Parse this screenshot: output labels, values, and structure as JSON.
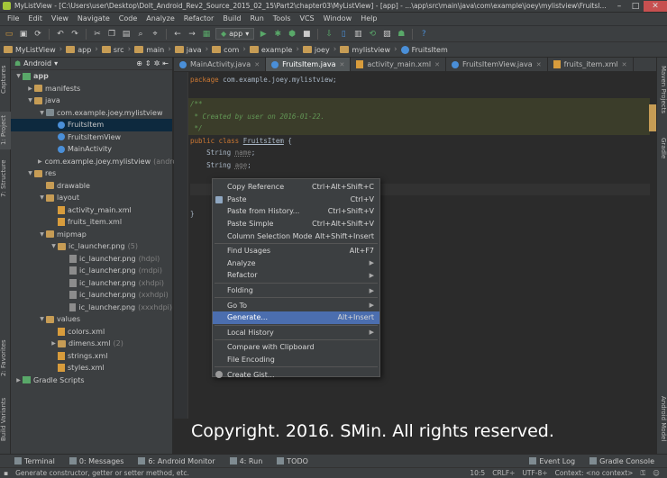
{
  "window": {
    "title": "MyListView - [C:\\Users\\user\\Desktop\\DoIt_Android_Rev2_Source_2015_02_15\\Part2\\chapter03\\MyListView] - [app] - ...\\app\\src\\main\\java\\com\\example\\joey\\mylistview\\FruitsI..."
  },
  "menu": [
    "File",
    "Edit",
    "View",
    "Navigate",
    "Code",
    "Analyze",
    "Refactor",
    "Build",
    "Run",
    "Tools",
    "VCS",
    "Window",
    "Help"
  ],
  "toolbar": {
    "run_config": "app"
  },
  "breadcrumb": [
    "MyListView",
    "app",
    "src",
    "main",
    "java",
    "com",
    "example",
    "joey",
    "mylistview",
    "FruitsItem"
  ],
  "side_tabs_left": [
    "Captures",
    "1: Project",
    "7: Structure",
    "2: Favorites",
    "Build Variants"
  ],
  "side_tabs_right": [
    "Maven Projects",
    "Gradle",
    "Android Model"
  ],
  "project": {
    "view_mode": "Android",
    "tree": [
      {
        "label": "app",
        "indent": 0,
        "arrow": "▼",
        "icon": "mod",
        "bold": true
      },
      {
        "label": "manifests",
        "indent": 1,
        "arrow": "▶",
        "icon": "folder"
      },
      {
        "label": "java",
        "indent": 1,
        "arrow": "▼",
        "icon": "folder"
      },
      {
        "label": "com.example.joey.mylistview",
        "indent": 2,
        "arrow": "▼",
        "icon": "pkg"
      },
      {
        "label": "FruitsItem",
        "indent": 3,
        "arrow": "",
        "icon": "cls",
        "selected": true
      },
      {
        "label": "FruitsItemView",
        "indent": 3,
        "arrow": "",
        "icon": "cls"
      },
      {
        "label": "MainActivity",
        "indent": 3,
        "arrow": "",
        "icon": "cls"
      },
      {
        "label": "com.example.joey.mylistview",
        "suffix": "(andro",
        "indent": 2,
        "arrow": "▶",
        "icon": "pkg"
      },
      {
        "label": "res",
        "indent": 1,
        "arrow": "▼",
        "icon": "folder"
      },
      {
        "label": "drawable",
        "indent": 2,
        "arrow": "",
        "icon": "folder"
      },
      {
        "label": "layout",
        "indent": 2,
        "arrow": "▼",
        "icon": "folder"
      },
      {
        "label": "activity_main.xml",
        "indent": 3,
        "arrow": "",
        "icon": "xml"
      },
      {
        "label": "fruits_item.xml",
        "indent": 3,
        "arrow": "",
        "icon": "xml"
      },
      {
        "label": "mipmap",
        "indent": 2,
        "arrow": "▼",
        "icon": "folder"
      },
      {
        "label": "ic_launcher.png",
        "suffix": "(5)",
        "indent": 3,
        "arrow": "▼",
        "icon": "folder"
      },
      {
        "label": "ic_launcher.png",
        "suffix": "(hdpi)",
        "indent": 4,
        "arrow": "",
        "icon": "png"
      },
      {
        "label": "ic_launcher.png",
        "suffix": "(mdpi)",
        "indent": 4,
        "arrow": "",
        "icon": "png"
      },
      {
        "label": "ic_launcher.png",
        "suffix": "(xhdpi)",
        "indent": 4,
        "arrow": "",
        "icon": "png"
      },
      {
        "label": "ic_launcher.png",
        "suffix": "(xxhdpi)",
        "indent": 4,
        "arrow": "",
        "icon": "png"
      },
      {
        "label": "ic_launcher.png",
        "suffix": "(xxxhdpi)",
        "indent": 4,
        "arrow": "",
        "icon": "png"
      },
      {
        "label": "values",
        "indent": 2,
        "arrow": "▼",
        "icon": "folder"
      },
      {
        "label": "colors.xml",
        "indent": 3,
        "arrow": "",
        "icon": "xml"
      },
      {
        "label": "dimens.xml",
        "suffix": "(2)",
        "indent": 3,
        "arrow": "▶",
        "icon": "folder"
      },
      {
        "label": "strings.xml",
        "indent": 3,
        "arrow": "",
        "icon": "xml"
      },
      {
        "label": "styles.xml",
        "indent": 3,
        "arrow": "",
        "icon": "xml"
      },
      {
        "label": "Gradle Scripts",
        "indent": 0,
        "arrow": "▶",
        "icon": "mod"
      }
    ]
  },
  "tabs": [
    {
      "label": "MainActivity.java",
      "active": false
    },
    {
      "label": "FruitsItem.java",
      "active": true
    },
    {
      "label": "activity_main.xml",
      "active": false
    },
    {
      "label": "FruitsItemView.java",
      "active": false
    },
    {
      "label": "fruits_item.xml",
      "active": false
    }
  ],
  "code": {
    "package_kw": "package",
    "package_name": "com.example.joey.mylistview;",
    "comment_open": "/**",
    "comment_body": " * Created by user on 2016-01-22.",
    "comment_close": " */",
    "class_decl_kw": "public class",
    "class_name": "FruitsItem",
    "class_brace": "{",
    "field1_type": "String",
    "field1_name": "name",
    "field2_type": "String",
    "field2_name": "age",
    "close_brace": "}"
  },
  "context_menu": [
    {
      "label": "Copy Reference",
      "shortcut": "Ctrl+Alt+Shift+C"
    },
    {
      "label": "Paste",
      "shortcut": "Ctrl+V",
      "icon": true
    },
    {
      "label": "Paste from History...",
      "shortcut": "Ctrl+Shift+V"
    },
    {
      "label": "Paste Simple",
      "shortcut": "Ctrl+Alt+Shift+V"
    },
    {
      "label": "Column Selection Mode",
      "shortcut": "Alt+Shift+Insert"
    },
    {
      "sep": true
    },
    {
      "label": "Find Usages",
      "shortcut": "Alt+F7"
    },
    {
      "label": "Analyze",
      "submenu": true
    },
    {
      "label": "Refactor",
      "submenu": true
    },
    {
      "sep": true
    },
    {
      "label": "Folding",
      "submenu": true
    },
    {
      "sep": true
    },
    {
      "label": "Go To",
      "submenu": true
    },
    {
      "label": "Generate...",
      "shortcut": "Alt+Insert",
      "highlight": true
    },
    {
      "sep": true
    },
    {
      "label": "Local History",
      "submenu": true
    },
    {
      "sep": true
    },
    {
      "label": "Compare with Clipboard"
    },
    {
      "label": "File Encoding"
    },
    {
      "sep": true
    },
    {
      "label": "Create Gist...",
      "icon": true
    }
  ],
  "watermark": "Copyright. 2016. SMin. All rights reserved.",
  "bottom_tools": [
    {
      "label": "Terminal"
    },
    {
      "label": "0: Messages"
    },
    {
      "label": "6: Android Monitor"
    },
    {
      "label": "4: Run"
    },
    {
      "label": "TODO"
    }
  ],
  "bottom_tools_right": [
    {
      "label": "Event Log"
    },
    {
      "label": "Gradle Console"
    }
  ],
  "status": {
    "message": "Generate constructor, getter or setter method, etc.",
    "position": "10:5",
    "line_sep": "CRLF÷",
    "encoding": "UTF-8÷",
    "context": "Context: <no context>"
  }
}
